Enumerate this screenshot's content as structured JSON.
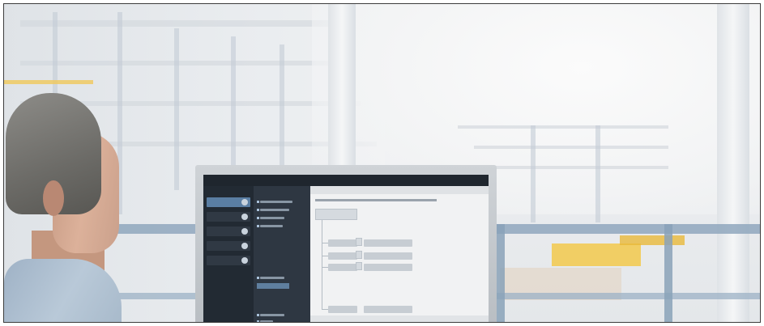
{
  "scene": {
    "colors": {
      "frame_border": "#3c3c3c",
      "screen_bg": "#2a323c",
      "nav_active": "#5a7ea3",
      "railing": "#8fa7bd",
      "machine_yellow": "#f2c94c"
    }
  }
}
